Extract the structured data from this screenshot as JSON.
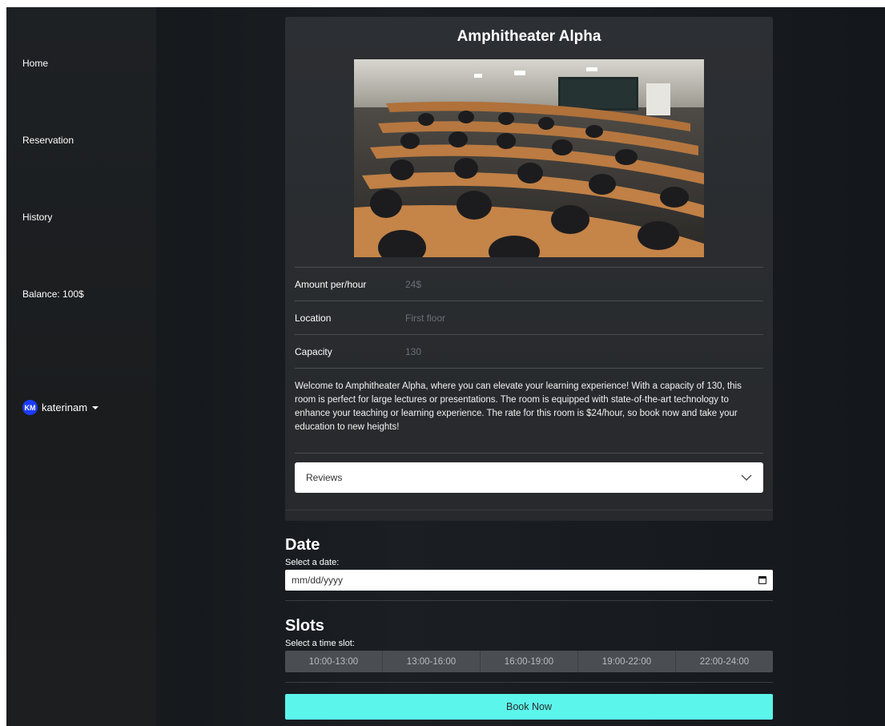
{
  "sidebar": {
    "items": [
      {
        "label": "Home"
      },
      {
        "label": "Reservation"
      },
      {
        "label": "History"
      }
    ],
    "balance": "Balance: 100$",
    "user": {
      "initials": "KM",
      "name": "katerinam"
    }
  },
  "room": {
    "title": "Amphitheater Alpha",
    "details": [
      {
        "label": "Amount per/hour",
        "value": "24$"
      },
      {
        "label": "Location",
        "value": "First floor"
      },
      {
        "label": "Capacity",
        "value": "130"
      }
    ],
    "description": "Welcome to Amphitheater Alpha, where you can elevate your learning experience! With a capacity of 130, this room is perfect for large lectures or presentations. The room is equipped with state-of-the-art technology to enhance your teaching or learning experience. The rate for this room is $24/hour, so book now and take your education to new heights!",
    "reviews_label": "Reviews"
  },
  "date": {
    "title": "Date",
    "hint": "Select a date:",
    "placeholder": "mm/dd/yyyy"
  },
  "slots": {
    "title": "Slots",
    "hint": "Select a time slot:",
    "options": [
      "10:00-13:00",
      "13:00-16:00",
      "16:00-19:00",
      "19:00-22:00",
      "22:00-24:00"
    ]
  },
  "book_label": "Book Now",
  "colors": {
    "accent": "#5cf5ec",
    "avatar": "#1a3cff"
  }
}
